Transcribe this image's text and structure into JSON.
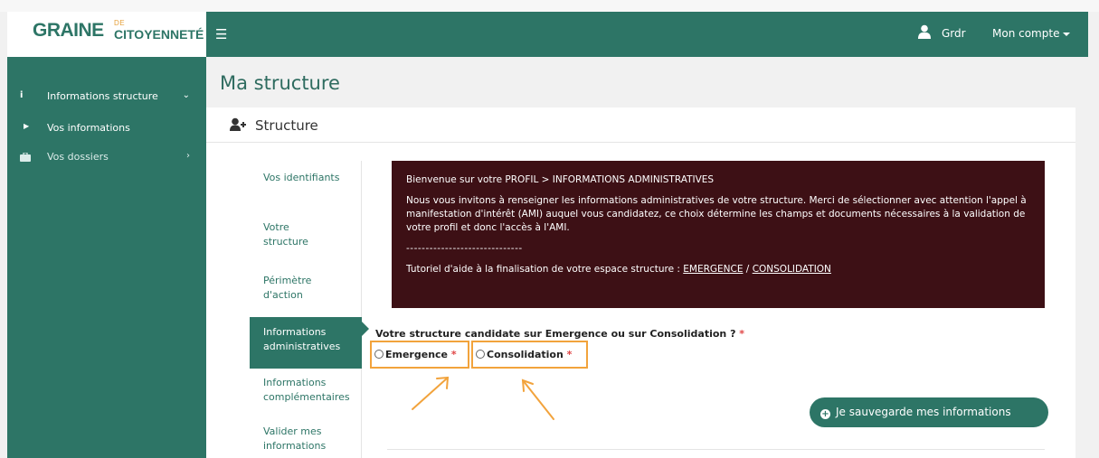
{
  "logo": {
    "main": "GRAINE",
    "small_top": "DE",
    "small_bottom": "CITOYENNETÉ"
  },
  "header": {
    "user_name": "Grdr",
    "account_label": "Mon compte"
  },
  "sidebar": {
    "items": [
      {
        "label": "Informations structure"
      },
      {
        "label": "Vos informations"
      },
      {
        "label": "Vos dossiers"
      }
    ]
  },
  "page": {
    "title": "Ma structure",
    "panel_title": "Structure"
  },
  "tabs": [
    {
      "label": "Vos identifiants"
    },
    {
      "label": "Votre structure"
    },
    {
      "label": "Périmètre d'action"
    },
    {
      "label": "Informations administratives"
    },
    {
      "label": "Informations complémentaires"
    },
    {
      "label": "Valider mes informations"
    }
  ],
  "infobox": {
    "line1": "Bienvenue sur votre PROFIL > INFORMATIONS ADMINISTRATIVES",
    "line2": "Nous vous invitons à renseigner les informations administratives de votre structure. Merci de sélectionner avec attention l'appel à manifestation d'intérêt (AMI) auquel vous candidatez, ce choix détermine les champs et documents nécessaires à la validation de votre profil et donc l'accès à l'AMI.",
    "separator": "------------------------------",
    "tutorial_prefix": "Tutoriel d'aide à la finalisation de votre espace structure : ",
    "link_emergence": "EMERGENCE",
    "link_separator": " / ",
    "link_consolidation": "CONSOLIDATION"
  },
  "form": {
    "question": "Votre structure candidate sur Emergence ou sur Consolidation ?",
    "required_mark": "*",
    "option_emergence": "Emergence",
    "option_consolidation": "Consolidation"
  },
  "save_button": {
    "label": "Je sauvegarde mes informations"
  },
  "colors": {
    "primary": "#2d7566",
    "info_bg": "#3d1015",
    "highlight": "#f2a33c",
    "required": "#e04545"
  }
}
